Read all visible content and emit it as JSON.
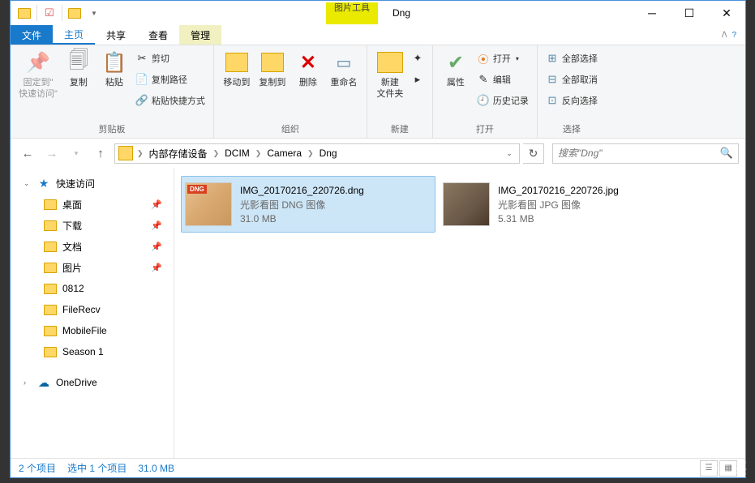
{
  "title_tool_tab": "图片工具",
  "window_title": "Dng",
  "ribbon_tabs": {
    "file": "文件",
    "home": "主页",
    "share": "共享",
    "view": "查看",
    "manage": "管理"
  },
  "ribbon": {
    "clipboard": {
      "pin": "固定到\"\n快速访问\"",
      "copy": "复制",
      "paste": "粘贴",
      "cut": "剪切",
      "copy_path": "复制路径",
      "paste_shortcut": "粘贴快捷方式",
      "group": "剪贴板"
    },
    "organize": {
      "move_to": "移动到",
      "copy_to": "复制到",
      "delete": "删除",
      "rename": "重命名",
      "group": "组织"
    },
    "new": {
      "new_folder": "新建\n文件夹",
      "group": "新建"
    },
    "open": {
      "properties": "属性",
      "open": "打开",
      "edit": "编辑",
      "history": "历史记录",
      "group": "打开"
    },
    "select": {
      "select_all": "全部选择",
      "select_none": "全部取消",
      "invert": "反向选择",
      "group": "选择"
    }
  },
  "breadcrumb": [
    "内部存储设备",
    "DCIM",
    "Camera",
    "Dng"
  ],
  "search_placeholder": "搜索\"Dng\"",
  "sidebar": {
    "quick_access": "快速访问",
    "items": [
      "桌面",
      "下载",
      "文档",
      "图片",
      "0812",
      "FileRecv",
      "MobileFile",
      "Season 1"
    ],
    "onedrive": "OneDrive"
  },
  "files": [
    {
      "name": "IMG_20170216_220726.dng",
      "type": "光影看图 DNG 图像",
      "size": "31.0 MB",
      "selected": true,
      "kind": "dng"
    },
    {
      "name": "IMG_20170216_220726.jpg",
      "type": "光影看图 JPG 图像",
      "size": "5.31 MB",
      "selected": false,
      "kind": "jpg"
    }
  ],
  "status": {
    "items": "2 个项目",
    "selected": "选中 1 个项目",
    "size": "31.0 MB"
  }
}
